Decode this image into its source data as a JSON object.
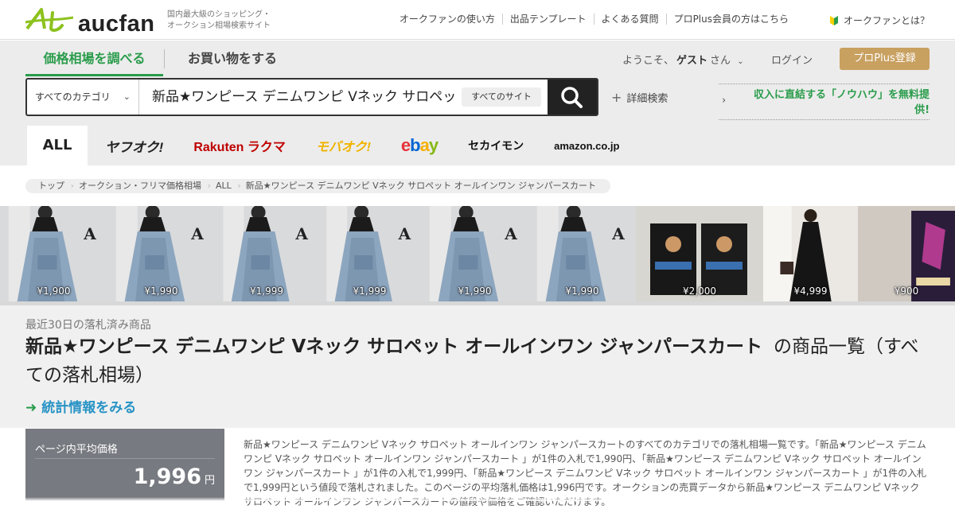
{
  "header": {
    "logo_text": "aucfan",
    "tagline": [
      "国内最大級のショッピング・",
      "オークション相場検索サイト"
    ],
    "nav": [
      "オークファンの使い方",
      "出品テンプレート",
      "よくある質問",
      "プロPlus会員の方はこちら"
    ],
    "what_is": "オークファンとは？"
  },
  "tabs": {
    "price": "価格相場を調べる",
    "shop": "お買い物をする"
  },
  "user": {
    "welcome": "ようこそ、",
    "guest": "ゲスト",
    "suffix": "さん",
    "login": "ログイン",
    "pro": "プロPlus登録"
  },
  "search": {
    "category": "すべてのカテゴリ",
    "query": "新品★ワンピース デニムワンピ Vネック サロペット オールインワン ジャンパースカート",
    "site": "すべてのサイト",
    "advanced": "詳細検索"
  },
  "promo": "収入に直結する「ノウハウ」を無料提供!",
  "sites": [
    "ALL",
    "ヤフオク!",
    "Rakuten ラクマ",
    "モバオク!",
    "ebay",
    "セカイモン",
    "amazon.co.jp"
  ],
  "colors": {
    "accent_green": "#2a9c4b",
    "pro_gold": "#c8a060",
    "link_blue": "#2893c5"
  },
  "breadcrumb": [
    "トップ",
    "オークション・フリマ価格相場",
    "ALL",
    "新品★ワンピース デニムワンピ Vネック サロペット オールインワン ジャンパースカート"
  ],
  "thumbnails": [
    {
      "price": "¥1,900",
      "kind": "denim-dress"
    },
    {
      "price": "¥1,990",
      "kind": "denim-dress"
    },
    {
      "price": "¥1,999",
      "kind": "denim-dress"
    },
    {
      "price": "¥1,999",
      "kind": "denim-dress"
    },
    {
      "price": "¥1,990",
      "kind": "denim-dress"
    },
    {
      "price": "¥1,990",
      "kind": "denim-dress"
    },
    {
      "price": "¥2,000",
      "kind": "figure-boxes"
    },
    {
      "price": "¥4,999",
      "kind": "black-dress"
    },
    {
      "price": "¥900",
      "kind": "figure-box"
    }
  ],
  "results": {
    "recent": "最近30日の落札済み商品",
    "title_bold": "新品★ワンピース デニムワンピ Vネック サロペット オールインワン ジャンパースカート",
    "title_suffix": "の商品一覧（すべての落札相場）",
    "stats_link": "統計情報をみる",
    "avg_label": "ページ内平均価格",
    "avg_value": "1,996",
    "avg_unit": "円",
    "description": "新品★ワンピース デニムワンピ Vネック サロペット オールインワン ジャンパースカートのすべてのカテゴリでの落札相場一覧です。「新品★ワンピース デニムワンピ Vネック サロペット オールインワン ジャンパースカート 」が1件の入札で1,990円、「新品★ワンピース デニムワンピ Vネック サロペット オールインワン ジャンパースカート 」が1件の入札で1,999円、「新品★ワンピース デニムワンピ Vネック サロペット オールインワン ジャンパースカート 」が1件の入札で1,999円という値段で落札されました。このページの平均落札価格は1,996円です。オークションの売買データから新品★ワンピース デニムワンピ Vネック サロペット オールインワン ジャンパースカートの値段や価格をご確認いただけます。"
  }
}
